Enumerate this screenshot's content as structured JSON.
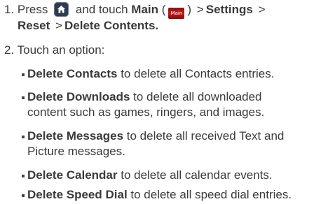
{
  "step1": {
    "number": "1.",
    "press": "Press",
    "and_touch": "and touch",
    "main": "Main",
    "main_icon_text": "Main",
    "open_paren": "(",
    "close_paren": ")",
    "sep": ">",
    "settings": "Settings",
    "reset": "Reset",
    "delete_contents": "Delete Contents."
  },
  "step2": {
    "number": "2.",
    "text": "Touch an option:"
  },
  "options": [
    {
      "bold": "Delete Contacts",
      "lines": [
        " to delete all Contacts entries."
      ]
    },
    {
      "bold": "Delete Downloads",
      "lines": [
        " to delete all downloaded",
        "content such as games, ringers, and images."
      ]
    },
    {
      "bold": "Delete Messages",
      "lines": [
        " to delete all received Text and",
        "Picture messages."
      ]
    },
    {
      "bold": "Delete Calendar",
      "lines": [
        " to delete all calendar events."
      ]
    },
    {
      "bold": "Delete Speed Dial",
      "lines": [
        " to delete all speed dial entries."
      ]
    }
  ]
}
